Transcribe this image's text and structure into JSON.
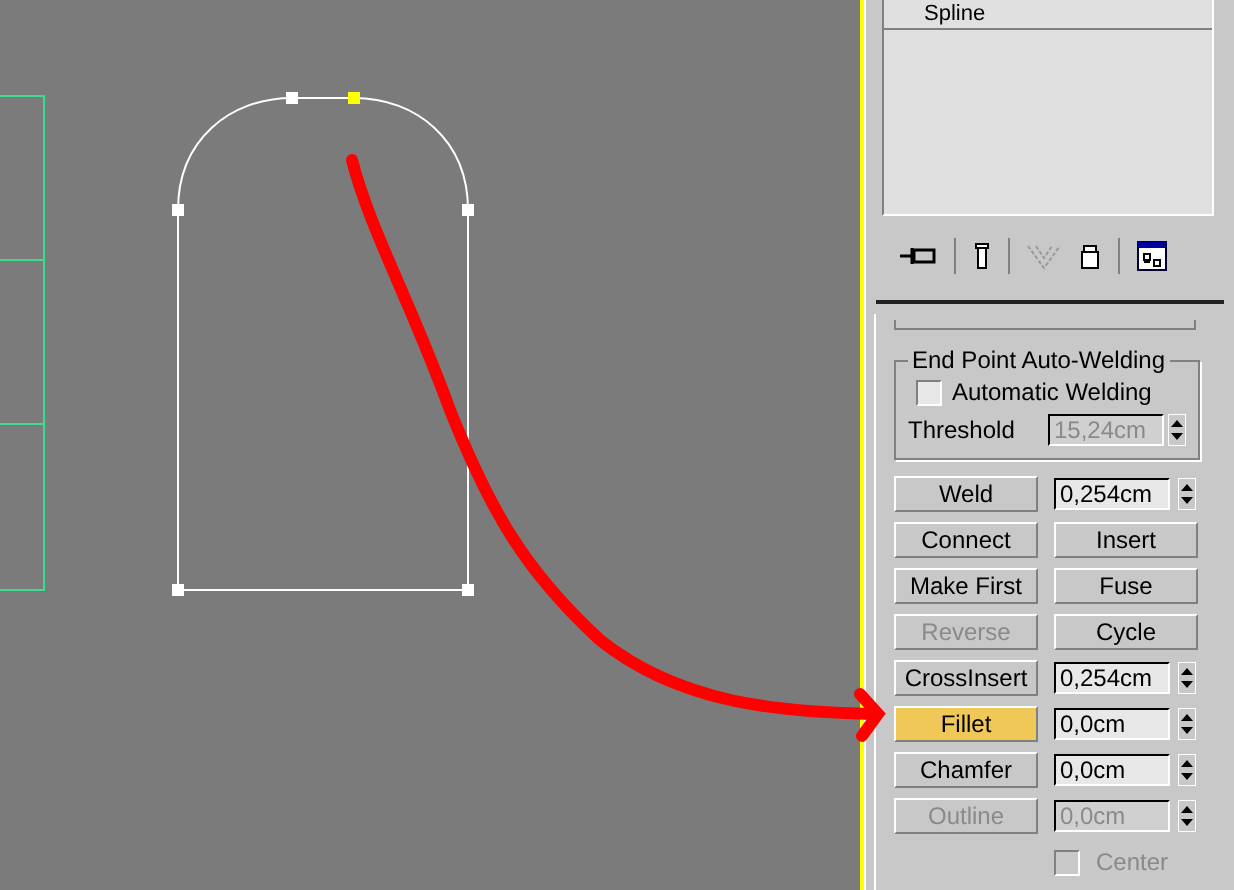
{
  "object_list": {
    "items": [
      {
        "label": "Spline",
        "selected": false
      }
    ]
  },
  "toolbar": {
    "tools": [
      {
        "kind": "pin",
        "disabled": false
      },
      {
        "kind": "stack",
        "disabled": false
      },
      {
        "kind": "funnel",
        "disabled": true
      },
      {
        "kind": "bin",
        "disabled": false
      },
      {
        "kind": "config",
        "disabled": false
      }
    ]
  },
  "auto_welding": {
    "title": "End Point Auto-Welding",
    "checkbox": {
      "label": "Automatic Welding",
      "checked": false
    },
    "threshold": {
      "label": "Threshold",
      "value": "15,24cm",
      "disabled": true
    }
  },
  "rows": [
    {
      "kind": "button-field",
      "button": {
        "label": "Weld",
        "disabled": false,
        "active": false
      },
      "field": {
        "value": "0,254cm",
        "disabled": false
      }
    },
    {
      "kind": "button-pair",
      "buttons": [
        {
          "label": "Connect",
          "disabled": false,
          "active": false
        },
        {
          "label": "Insert",
          "disabled": false,
          "active": false
        }
      ]
    },
    {
      "kind": "button-pair",
      "buttons": [
        {
          "label": "Make First",
          "disabled": false,
          "active": false
        },
        {
          "label": "Fuse",
          "disabled": false,
          "active": false
        }
      ]
    },
    {
      "kind": "button-pair",
      "buttons": [
        {
          "label": "Reverse",
          "disabled": true,
          "active": false
        },
        {
          "label": "Cycle",
          "disabled": false,
          "active": false
        }
      ]
    },
    {
      "kind": "button-field",
      "button": {
        "label": "CrossInsert",
        "disabled": false,
        "active": false
      },
      "field": {
        "value": "0,254cm",
        "disabled": false
      }
    },
    {
      "kind": "button-field",
      "button": {
        "label": "Fillet",
        "disabled": false,
        "active": true
      },
      "field": {
        "value": "0,0cm",
        "disabled": false
      }
    },
    {
      "kind": "button-field",
      "button": {
        "label": "Chamfer",
        "disabled": false,
        "active": false
      },
      "field": {
        "value": "0,0cm",
        "disabled": false
      }
    },
    {
      "kind": "button-field",
      "button": {
        "label": "Outline",
        "disabled": true,
        "active": false
      },
      "field": {
        "value": "0,0cm",
        "disabled": true
      }
    },
    {
      "kind": "checkbox",
      "label": "Center",
      "checked": false,
      "disabled": true
    }
  ]
}
